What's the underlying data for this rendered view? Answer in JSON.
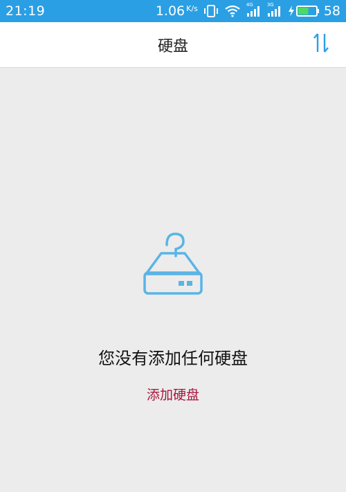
{
  "status_bar": {
    "time": "21:19",
    "net_speed": "1.06",
    "net_unit": "K/s",
    "signal1_label": "4G",
    "signal2_label": "3G",
    "battery_level": "58",
    "battery_fraction": 0.58,
    "bg_color": "#2a9fe4",
    "icons": [
      "vibrate-icon",
      "wifi-icon",
      "signal-icon",
      "charging-icon",
      "battery-icon"
    ]
  },
  "app_bar": {
    "title": "硬盘",
    "sort_icon": "sort-arrows-icon",
    "accent_color": "#2a9fe4"
  },
  "empty_state": {
    "icon": "disk-question-icon",
    "message": "您没有添加任何硬盘",
    "action_label": "添加硬盘",
    "action_color": "#a8153b"
  }
}
